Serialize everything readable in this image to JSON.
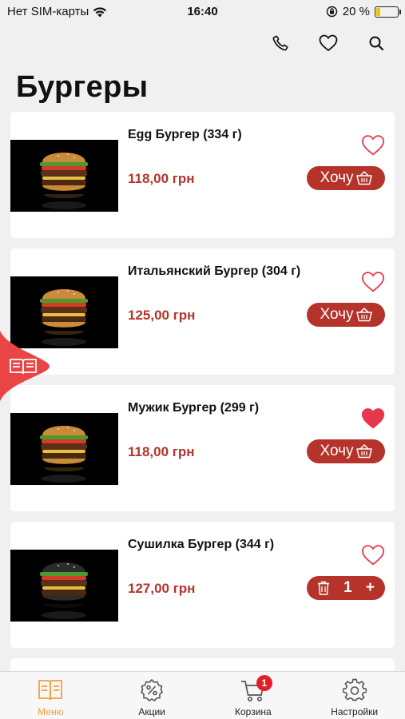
{
  "status_bar": {
    "carrier": "Нет SIM-карты",
    "time": "16:40",
    "battery": "20 %",
    "battery_level": 0.2
  },
  "top_actions": {
    "phone_icon": "phone-icon",
    "favorites_icon": "heart-outline-icon",
    "search_icon": "search-icon"
  },
  "page": {
    "title": "Бургеры"
  },
  "colors": {
    "accent": "#b5332a",
    "favorite": "#e8364f",
    "tab_active": "#f0a040",
    "badge": "#e0202a"
  },
  "products": [
    {
      "name": "Egg Бургер (334 г)",
      "price": "118,00 грн",
      "favorite": false,
      "action": "Хочу",
      "bun": "#c98a3a"
    },
    {
      "name": "Итальянский Бургер (304 г)",
      "price": "125,00 грн",
      "favorite": false,
      "action": "Хочу",
      "bun": "#cc8b3c"
    },
    {
      "name": "Мужик Бургер (299 г)",
      "price": "118,00 грн",
      "favorite": true,
      "action": "Хочу",
      "bun": "#c98a3a"
    },
    {
      "name": "Сушилка Бургер (344 г)",
      "price": "127,00 грн",
      "favorite": false,
      "in_cart": true,
      "quantity": "1",
      "bun": "#2b2b2b"
    }
  ],
  "tabbar": {
    "items": [
      {
        "label": "Меню",
        "icon": "menu-book-icon",
        "active": true
      },
      {
        "label": "Акции",
        "icon": "discount-badge-icon",
        "active": false
      },
      {
        "label": "Корзина",
        "icon": "cart-icon",
        "active": false,
        "badge": "1"
      },
      {
        "label": "Настройки",
        "icon": "gear-icon",
        "active": false
      }
    ]
  }
}
